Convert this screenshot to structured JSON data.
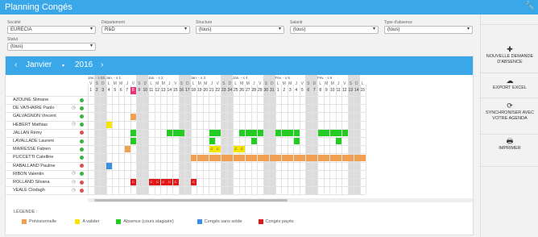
{
  "app": {
    "title": "Planning Congés"
  },
  "filters": [
    {
      "label": "Société",
      "value": "EURECIA"
    },
    {
      "label": "Département",
      "value": "R&D"
    },
    {
      "label": "Structure",
      "value": "(tous)"
    },
    {
      "label": "Salarié",
      "value": "(tous)"
    },
    {
      "label": "Type d'absence",
      "value": "(tous)"
    },
    {
      "label": "Statut",
      "value": "(tous)"
    }
  ],
  "actions": {
    "new": "NOUVELLE DEMANDE D'ABSENCE",
    "export": "EXPORT EXCEL",
    "sync": "SYNCHRONISER AVEC VOTRE AGENDA",
    "print": "IMPRIMER"
  },
  "nav": {
    "month": "Janvier",
    "year": "2016"
  },
  "weeks": [
    {
      "label": "Jan. - s 53",
      "start": 1
    },
    {
      "label": "Jan. - s 1",
      "start": 4
    },
    {
      "label": "Jan. - s 2",
      "start": 11
    },
    {
      "label": "Jan. - s 3",
      "start": 18
    },
    {
      "label": "Jan. - s 4",
      "start": 25
    },
    {
      "label": "Fév. - s 5",
      "start": 32
    },
    {
      "label": "Fév. - s 6",
      "start": 39
    }
  ],
  "days": [
    {
      "l": "V",
      "n": "1"
    },
    {
      "l": "S",
      "n": "2"
    },
    {
      "l": "D",
      "n": "3"
    },
    {
      "l": "L",
      "n": "4"
    },
    {
      "l": "M",
      "n": "5"
    },
    {
      "l": "M",
      "n": "6"
    },
    {
      "l": "J",
      "n": "7"
    },
    {
      "l": "V",
      "n": "8"
    },
    {
      "l": "S",
      "n": "9"
    },
    {
      "l": "D",
      "n": "10"
    },
    {
      "l": "L",
      "n": "11"
    },
    {
      "l": "M",
      "n": "12"
    },
    {
      "l": "M",
      "n": "13"
    },
    {
      "l": "J",
      "n": "14"
    },
    {
      "l": "V",
      "n": "15"
    },
    {
      "l": "S",
      "n": "16"
    },
    {
      "l": "D",
      "n": "17"
    },
    {
      "l": "L",
      "n": "18"
    },
    {
      "l": "M",
      "n": "19"
    },
    {
      "l": "M",
      "n": "20"
    },
    {
      "l": "J",
      "n": "21"
    },
    {
      "l": "V",
      "n": "22"
    },
    {
      "l": "S",
      "n": "23"
    },
    {
      "l": "D",
      "n": "24"
    },
    {
      "l": "L",
      "n": "25"
    },
    {
      "l": "M",
      "n": "26"
    },
    {
      "l": "M",
      "n": "27"
    },
    {
      "l": "J",
      "n": "28"
    },
    {
      "l": "V",
      "n": "29"
    },
    {
      "l": "S",
      "n": "30"
    },
    {
      "l": "D",
      "n": "31"
    },
    {
      "l": "L",
      "n": "1"
    },
    {
      "l": "M",
      "n": "2"
    },
    {
      "l": "M",
      "n": "3"
    },
    {
      "l": "J",
      "n": "4"
    },
    {
      "l": "V",
      "n": "5"
    },
    {
      "l": "S",
      "n": "6"
    },
    {
      "l": "D",
      "n": "7"
    },
    {
      "l": "L",
      "n": "8"
    },
    {
      "l": "M",
      "n": "9"
    },
    {
      "l": "M",
      "n": "10"
    },
    {
      "l": "J",
      "n": "11"
    },
    {
      "l": "V",
      "n": "12"
    },
    {
      "l": "S",
      "n": "13"
    },
    {
      "l": "D",
      "n": "14"
    },
    {
      "l": "L",
      "n": "15"
    }
  ],
  "today_index": 7,
  "weekend_indices": [
    1,
    2,
    8,
    9,
    15,
    16,
    22,
    23,
    29,
    30,
    36,
    37,
    43,
    44
  ],
  "employees": [
    {
      "name": "AZOUNE Slimane",
      "clock": false,
      "status": "green",
      "blocks": []
    },
    {
      "name": "DE VATHAIRE Paolo",
      "clock": true,
      "status": "green",
      "blocks": []
    },
    {
      "name": "GALVAGNON Vincent",
      "clock": false,
      "status": "green",
      "blocks": [
        {
          "s": 7,
          "e": 7,
          "type": "previsionnelle",
          "text": ""
        }
      ]
    },
    {
      "name": "HEBERT Mathias",
      "clock": true,
      "status": "green",
      "blocks": [
        {
          "s": 3,
          "e": 3,
          "type": "avalider",
          "text": ""
        }
      ]
    },
    {
      "name": "JALLAN Rémy",
      "clock": false,
      "status": "red",
      "blocks": [
        {
          "s": 7,
          "e": 7,
          "type": "absence",
          "text": ""
        },
        {
          "s": 13,
          "e": 15,
          "type": "absence",
          "text": ""
        },
        {
          "s": 20,
          "e": 21,
          "type": "absence",
          "text": ""
        },
        {
          "s": 25,
          "e": 28,
          "type": "absence",
          "text": ""
        },
        {
          "s": 31,
          "e": 34,
          "type": "absence",
          "text": ""
        },
        {
          "s": 38,
          "e": 42,
          "type": "absence",
          "text": ""
        }
      ]
    },
    {
      "name": "LAVALLADE Laurent",
      "clock": false,
      "status": "green",
      "blocks": [
        {
          "s": 7,
          "e": 7,
          "type": "absence",
          "text": ""
        },
        {
          "s": 20,
          "e": 20,
          "type": "absence",
          "text": ""
        },
        {
          "s": 27,
          "e": 27,
          "type": "absence",
          "text": ""
        },
        {
          "s": 34,
          "e": 34,
          "type": "absence",
          "text": ""
        },
        {
          "s": 41,
          "e": 41,
          "type": "absence",
          "text": ""
        }
      ]
    },
    {
      "name": "MAIRESSE Fabien",
      "clock": false,
      "status": "green",
      "blocks": [
        {
          "s": 6,
          "e": 6,
          "type": "previsionnelle",
          "text": ""
        },
        {
          "s": 20,
          "e": 21,
          "type": "avalider",
          "text": "C"
        },
        {
          "s": 24,
          "e": 25,
          "type": "avalider",
          "text": "C"
        }
      ]
    },
    {
      "name": "PUCCETTI Catelline",
      "clock": false,
      "status": "green",
      "blocks": [
        {
          "s": 17,
          "e": 45,
          "type": "previsionnelle",
          "text": ""
        }
      ]
    },
    {
      "name": "RABALLAND Pauline",
      "clock": false,
      "status": "red",
      "blocks": [
        {
          "s": 3,
          "e": 3,
          "type": "sanssolde",
          "text": ""
        }
      ]
    },
    {
      "name": "RIBON Valentin",
      "clock": true,
      "status": "green",
      "blocks": []
    },
    {
      "name": "ROLLAND Silvana",
      "clock": true,
      "status": "red",
      "blocks": [
        {
          "s": 7,
          "e": 7,
          "type": "payes",
          "text": "C"
        },
        {
          "s": 10,
          "e": 14,
          "type": "payes",
          "text": "C"
        },
        {
          "s": 17,
          "e": 17,
          "type": "payes",
          "text": "C"
        }
      ]
    },
    {
      "name": "VEALE Clodagh",
      "clock": true,
      "status": "red",
      "blocks": []
    }
  ],
  "legend": {
    "title": "LÉGENDE :",
    "items": [
      {
        "label": "Prévisionnelle",
        "color": "#f0a050"
      },
      {
        "label": "A valider",
        "color": "#f5e600"
      },
      {
        "label": "Absence (cours stagiaire)",
        "color": "#22cc22"
      },
      {
        "label": "Congés sans solde",
        "color": "#3b8fe0"
      },
      {
        "label": "Congés payés",
        "color": "#e01818"
      }
    ]
  },
  "colors": {
    "previsionnelle": "#f0a050",
    "avalider": "#f5e600",
    "absence": "#22cc22",
    "sanssolde": "#3b8fe0",
    "payes": "#e01818",
    "green": "#3cb043",
    "red": "#d9534f",
    "today": "#e8347a",
    "weekend": "#dcdcdc"
  }
}
